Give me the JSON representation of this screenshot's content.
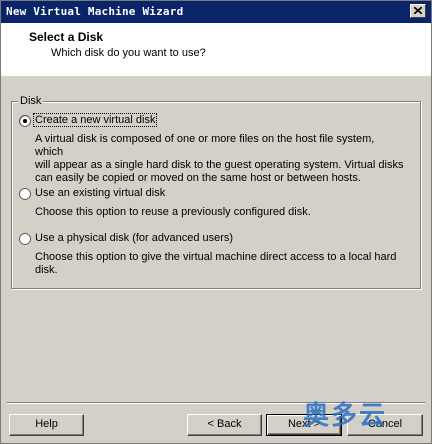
{
  "window": {
    "title": "New Virtual Machine Wizard"
  },
  "header": {
    "title": "Select a Disk",
    "subtitle": "Which disk do you want to use?"
  },
  "group": {
    "label": "Disk"
  },
  "options": [
    {
      "label": "Create a new virtual disk",
      "selected": true,
      "desc": [
        "A virtual disk is composed of one or more files on the host file system, which",
        "will appear as a single hard disk to the guest operating system. Virtual disks",
        "can easily be copied or moved on the same host or between hosts."
      ]
    },
    {
      "label": "Use an existing virtual disk",
      "selected": false,
      "desc": [
        "Choose this option to reuse a previously configured disk."
      ]
    },
    {
      "label": "Use a physical disk (for advanced users)",
      "selected": false,
      "desc": [
        "Choose this option to give the virtual machine direct access to a local hard",
        "disk."
      ]
    }
  ],
  "buttons": {
    "help": "Help",
    "back": "< Back",
    "next": "Next >",
    "cancel": "Cancel"
  },
  "watermark": "奥多云"
}
